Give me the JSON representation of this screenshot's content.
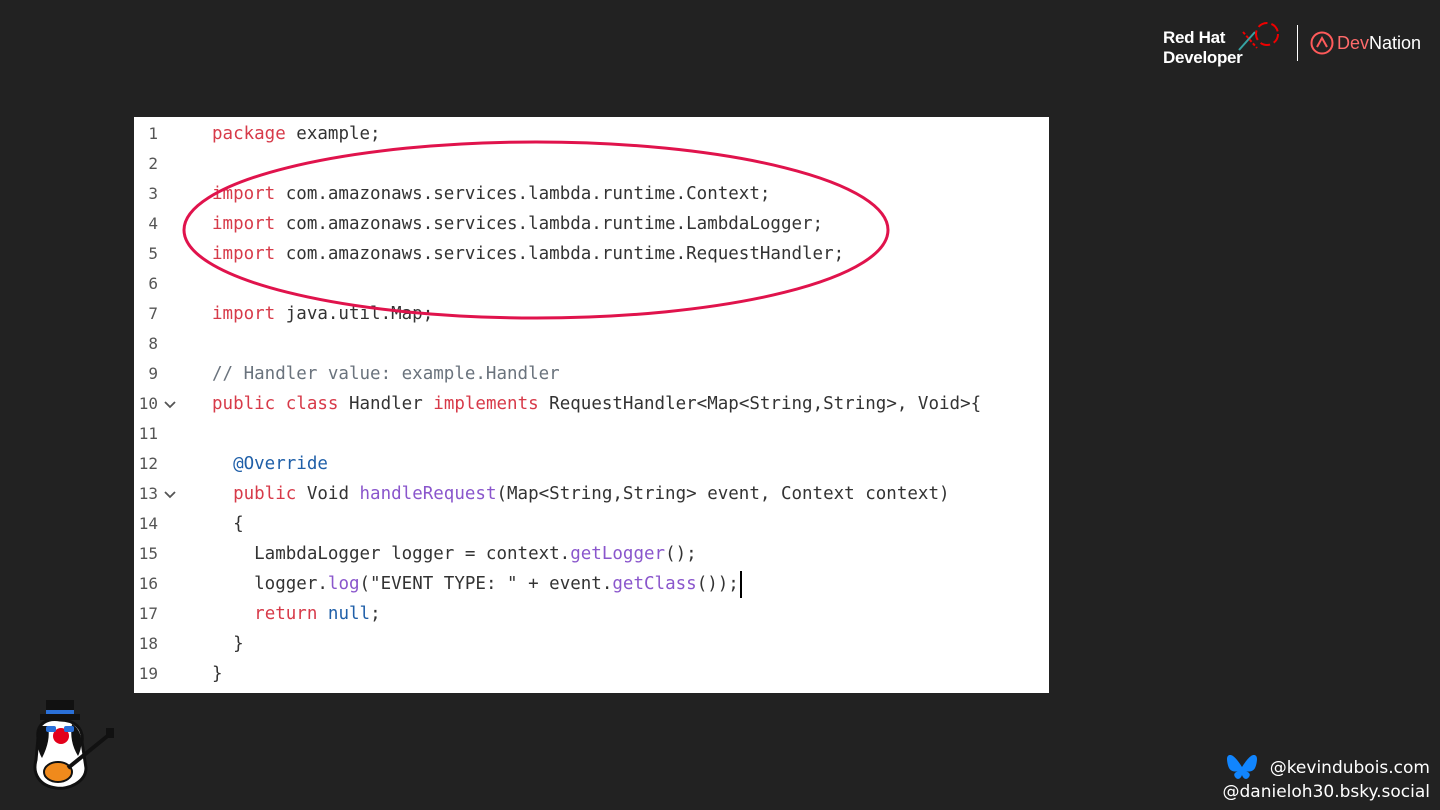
{
  "branding": {
    "redhat_line1": "Red Hat",
    "redhat_line2": "Developer",
    "devnation_dev": "Dev",
    "devnation_nation": "Nation"
  },
  "code": {
    "lines": [
      {
        "num": "1",
        "text": "package example;"
      },
      {
        "num": "2",
        "text": ""
      },
      {
        "num": "3",
        "text": "import com.amazonaws.services.lambda.runtime.Context;"
      },
      {
        "num": "4",
        "text": "import com.amazonaws.services.lambda.runtime.LambdaLogger;"
      },
      {
        "num": "5",
        "text": "import com.amazonaws.services.lambda.runtime.RequestHandler;"
      },
      {
        "num": "6",
        "text": ""
      },
      {
        "num": "7",
        "text": "import java.util.Map;"
      },
      {
        "num": "8",
        "text": ""
      },
      {
        "num": "9",
        "text": "// Handler value: example.Handler"
      },
      {
        "num": "10",
        "text": "public class Handler implements RequestHandler<Map<String,String>, Void>{"
      },
      {
        "num": "11",
        "text": ""
      },
      {
        "num": "12",
        "text": "  @Override"
      },
      {
        "num": "13",
        "text": "  public Void handleRequest(Map<String,String> event, Context context)"
      },
      {
        "num": "14",
        "text": "  {"
      },
      {
        "num": "15",
        "text": "    LambdaLogger logger = context.getLogger();"
      },
      {
        "num": "16",
        "text": "    logger.log(\"EVENT TYPE: \" + event.getClass());"
      },
      {
        "num": "17",
        "text": "    return null;"
      },
      {
        "num": "18",
        "text": "  }"
      },
      {
        "num": "19",
        "text": "}"
      }
    ],
    "folded_lines": [
      "10",
      "13"
    ],
    "colors": {
      "keyword": "#d73a49",
      "comment": "#6a737d",
      "annotation": "#1f5fa8",
      "method": "#8a56cc",
      "highlight_oval": "#e0134c"
    }
  },
  "social": {
    "handle1": "@kevindubois.com",
    "handle2": "@danieloh30.bsky.social"
  }
}
